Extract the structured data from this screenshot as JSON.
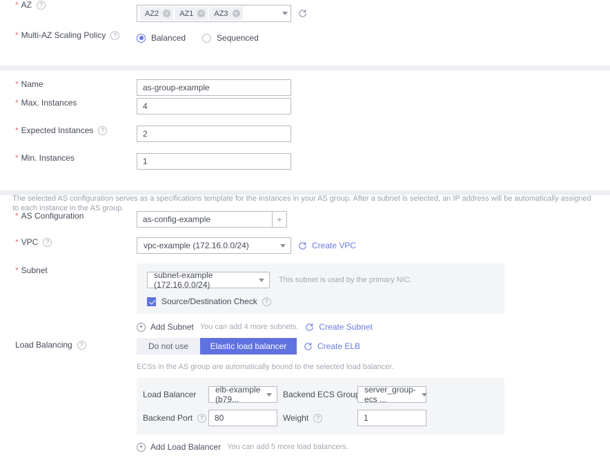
{
  "az": {
    "label": "AZ",
    "help": "?",
    "tags": [
      "AZ2",
      "AZ1",
      "AZ3"
    ],
    "remove_icon": "×",
    "refresh_icon": "refresh-icon"
  },
  "multi_az": {
    "label": "Multi-AZ Scaling Policy",
    "help": "?",
    "options": [
      {
        "label": "Balanced",
        "selected": true
      },
      {
        "label": "Sequenced",
        "selected": false
      }
    ]
  },
  "group": {
    "name": {
      "label": "Name",
      "value": "as-group-example"
    },
    "max_instances": {
      "label": "Max. Instances",
      "value": "4"
    },
    "expected_instances": {
      "label": "Expected Instances",
      "value": "2",
      "help": "?"
    },
    "min_instances": {
      "label": "Min. Instances",
      "value": "1"
    }
  },
  "banner": "The selected AS configuration serves as a specifications template for the instances in your AS group. After a subnet is selected, an IP address will be automatically assigned to each instance in the AS group.",
  "as_config": {
    "label": "AS Configuration",
    "value": "as-config-example",
    "add_icon": "+"
  },
  "vpc": {
    "label": "VPC",
    "help": "?",
    "value": "vpc-example (172.16.0.0/24)",
    "create_link": "Create VPC"
  },
  "subnet": {
    "label": "Subnet",
    "value": "subnet-example (172.16.0.0/24)",
    "note": "This subnet is used by the primary NIC.",
    "check_label": "Source/Destination Check",
    "check_help": "?",
    "checked": true,
    "add_label": "Add Subnet",
    "add_hint": "You can add 4 more subnets.",
    "create_link": "Create Subnet"
  },
  "load_balancing": {
    "label": "Load Balancing",
    "help": "?",
    "options": [
      {
        "label": "Do not use",
        "active": false
      },
      {
        "label": "Elastic load balancer",
        "active": true
      }
    ],
    "create_link": "Create ELB",
    "note": "ECSs in the AS group are automatically bound to the selected load balancer.",
    "fields": {
      "load_balancer_label": "Load Balancer",
      "load_balancer_value": "elb-example (b79...",
      "backend_group_label": "Backend ECS Group",
      "backend_group_value": "server_group-ecs ...",
      "backend_port_label": "Backend Port",
      "backend_port_help": "?",
      "backend_port_value": "80",
      "weight_label": "Weight",
      "weight_help": "?",
      "weight_value": "1"
    },
    "add_label": "Add Load Balancer",
    "add_hint": "You can add 5 more load balancers."
  },
  "colors": {
    "accent": "#5f72e0",
    "link": "#6a7ae0",
    "required": "#f06e6e",
    "panel": "#f4f5f7",
    "divider": "#eceef2"
  }
}
